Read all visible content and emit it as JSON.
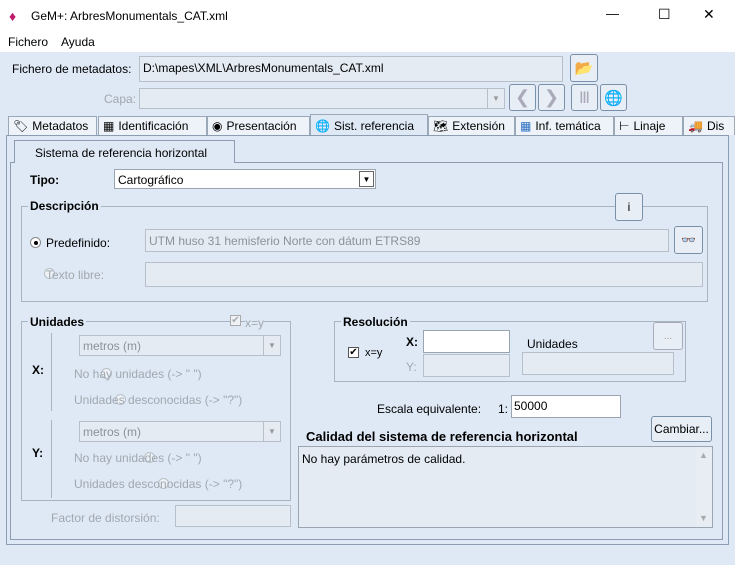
{
  "window": {
    "title": "GeM+: ArbresMonumentals_CAT.xml",
    "minimize": "—",
    "maximize": "☐",
    "close": "✕"
  },
  "menu": [
    "Fichero",
    "Ayuda"
  ],
  "file": {
    "label": "Fichero de metadatos:",
    "value": "D:\\mapes\\XML\\ArbresMonumentals_CAT.xml"
  },
  "layer": {
    "label": "Capa:",
    "value": ""
  },
  "tabs": [
    "Metadatos",
    "Identificación",
    "Presentación",
    "Sist. referencia",
    "Extensión",
    "Inf. temática",
    "Linaje",
    "Dis"
  ],
  "subtab": "Sistema de referencia horizontal",
  "tipo": {
    "label": "Tipo:",
    "value": "Cartográfico"
  },
  "descripcion": {
    "title": "Descripción",
    "info": "i",
    "predefinido_label": "Predefinido:",
    "predefinido_value": "UTM huso 31 hemisferio Norte con dátum ETRS89",
    "texto_libre_label": "Texto libre:",
    "texto_libre_value": ""
  },
  "unidades": {
    "title": "Unidades",
    "xy": "x=y",
    "x_label": "X:",
    "y_label": "Y:",
    "units_value": "metros (m)",
    "no_units": "No hay unidades (-> \" \")",
    "unknown_units": "Unidades desconocidas (-> \"?\")"
  },
  "factor": {
    "label": "Factor de distorsión:",
    "value": ""
  },
  "resolucion": {
    "title": "Resolución",
    "xy": "x=y",
    "x_label": "X:",
    "y_label": "Y:",
    "x_value": "",
    "y_value": "",
    "units_label": "Unidades",
    "units_value": "",
    "more": "..."
  },
  "escala": {
    "label": "Escala equivalente:",
    "prefix": "1:",
    "value": "50000"
  },
  "calidad": {
    "title": "Calidad del sistema de referencia horizontal",
    "button": "Cambiar...",
    "text": "No hay parámetros de calidad."
  }
}
